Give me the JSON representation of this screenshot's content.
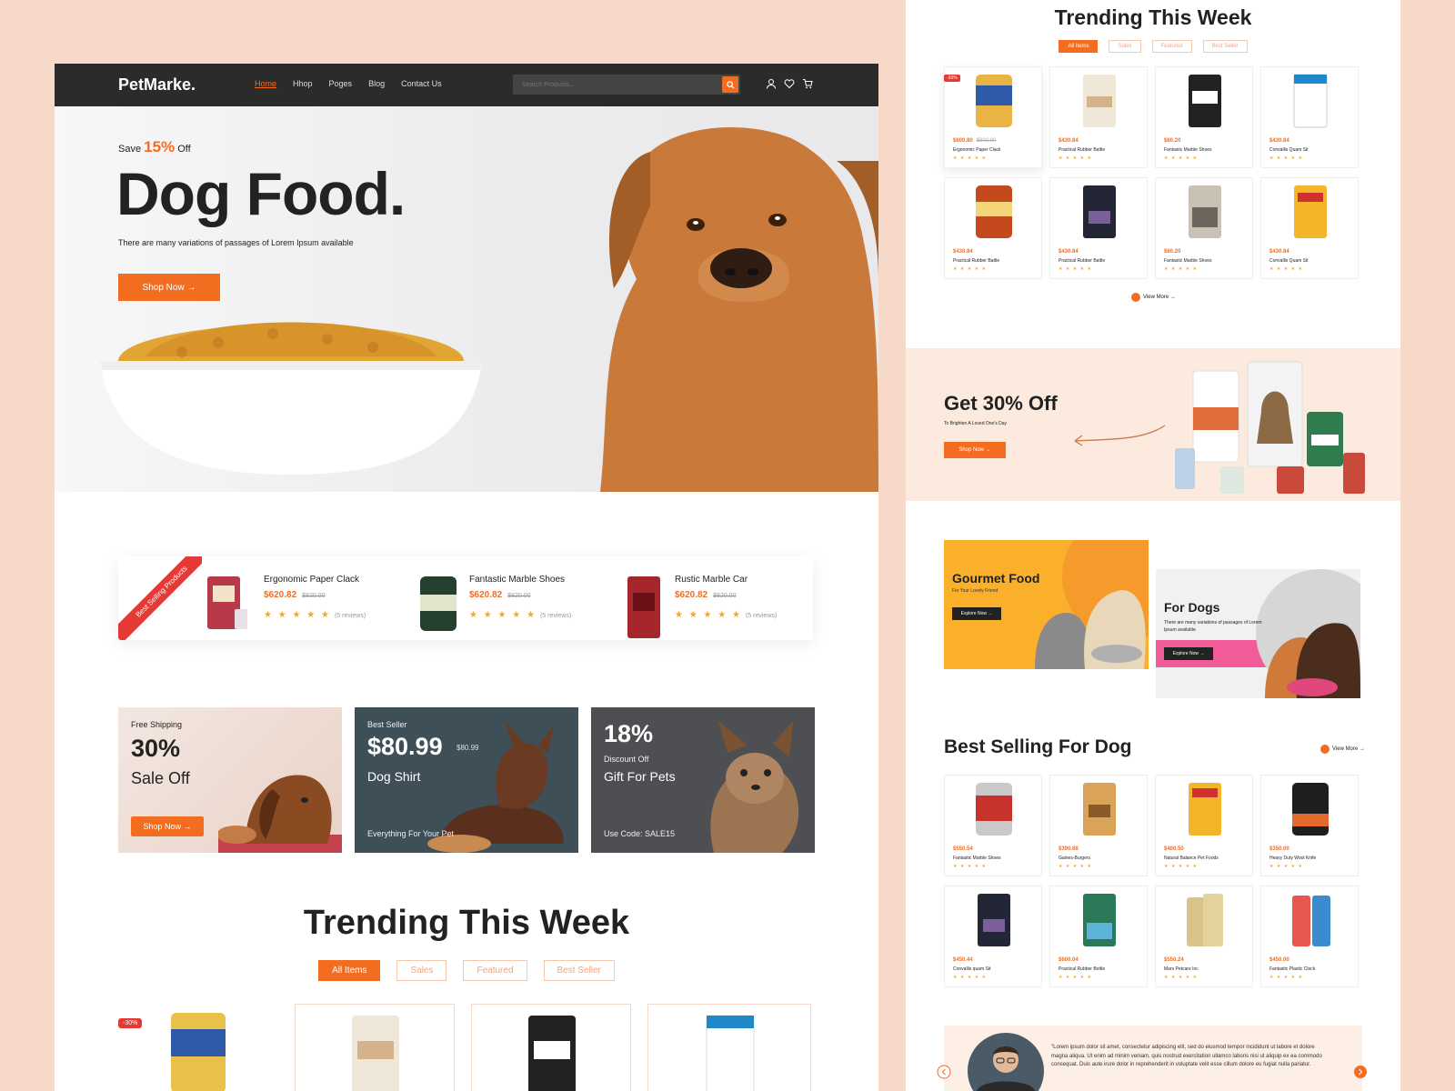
{
  "nav": {
    "logo": "PetMarke.",
    "items": [
      "Home",
      "Hhop",
      "Poges",
      "Blog",
      "Contact Us"
    ],
    "search_placeholder": "Search Products..."
  },
  "hero": {
    "save_prefix": "Save",
    "save_pct": "15%",
    "save_suffix": "Off",
    "title": "Dog Food.",
    "subtitle": "There are many variations of passages of Lorem Ipsum available",
    "cta": "Shop Now →"
  },
  "best_selling_strip": {
    "ribbon": "Best Selling Products",
    "items": [
      {
        "name": "Ergonomic Paper Clack",
        "price": "$620.82",
        "old": "$820.00",
        "stars": "★ ★ ★ ★ ★",
        "reviews": "(5 reviews)"
      },
      {
        "name": "Fantastic Marble Shoes",
        "price": "$620.82",
        "old": "$820.00",
        "stars": "★ ★ ★ ★ ★",
        "reviews": "(5 reviews)"
      },
      {
        "name": "Rustic Marble Car",
        "price": "$620.82",
        "old": "$820.00",
        "stars": "★ ★ ★ ★ ★",
        "reviews": "(5 reviews)"
      }
    ]
  },
  "promos": [
    {
      "kicker": "Free Shipping",
      "big": "30%",
      "line": "Sale Off",
      "cta": "Shop Now →"
    },
    {
      "kicker": "Best Seller",
      "big": "$80.99",
      "old": "$80.99",
      "line": "Dog Shirt",
      "foot": "Everything For Your Pet"
    },
    {
      "big": "18%",
      "kicker": "Discount Off",
      "line": "Gift For Pets",
      "foot": "Use Code: SALE15"
    }
  ],
  "trending": {
    "title": "Trending This Week",
    "tabs": [
      "All Items",
      "Sales",
      "Featured",
      "Best Seller"
    ],
    "discount_badge": "-30%"
  },
  "right": {
    "trending_title": "Trending This Week",
    "tabs": [
      "All Items",
      "Sales",
      "Featured",
      "Best Seller"
    ],
    "badge": "-30%",
    "products_row1": [
      {
        "price": "$600.80",
        "old": "$800.00",
        "name": "Ergonomic Paper Clack"
      },
      {
        "price": "$430.84",
        "name": "Practical Rubber Battle"
      },
      {
        "price": "$60.20",
        "name": "Fantastic Marble Shoes"
      },
      {
        "price": "$430.84",
        "name": "Convallis Quam Sit"
      }
    ],
    "products_row2": [
      {
        "price": "$430.84",
        "name": "Practical Rubber Battle"
      },
      {
        "price": "$430.84",
        "name": "Practical Rubber Battle"
      },
      {
        "price": "$60.20",
        "name": "Fantastic Marble Shoes"
      },
      {
        "price": "$430.84",
        "name": "Convallis Quam Sit"
      }
    ],
    "view_more": "View More →",
    "offer": {
      "title": "Get 30% Off",
      "sub": "To Brighten A Loved One's Day",
      "cta": "Shop Now →"
    },
    "gourmet": {
      "title": "Gourmet Food",
      "sub": "For Your Lovely Friend",
      "cta": "Explore Now →"
    },
    "for_dogs": {
      "title": "For Dogs",
      "sub": "There are many variations of passages of Lorem Ipsum available",
      "cta": "Explore Now →"
    },
    "best_selling_title": "Best Selling For Dog",
    "bs_row1": [
      {
        "price": "$550.54",
        "name": "Fantastic Marble Shoes"
      },
      {
        "price": "$390.88",
        "name": "Gaines-Burgers"
      },
      {
        "price": "$400.50",
        "name": "Natural Balance Pet Foods"
      },
      {
        "price": "$350.00",
        "name": "Heavy Duty Wool Knife"
      }
    ],
    "bs_row2": [
      {
        "price": "$450.44",
        "name": "Convallis quam Sit"
      },
      {
        "price": "$600.04",
        "name": "Practical Rubber Bottle"
      },
      {
        "price": "$550.24",
        "name": "Mars Petcare Inc"
      },
      {
        "price": "$450.00",
        "name": "Fantastic Plastic Clock"
      }
    ],
    "stars": "★ ★ ★ ★ ★",
    "testimonial": "\"Lorem ipsum dolor sit amet, consectetur adipiscing elit, sed do eiusmod tempor incididunt ut labore et dolore magna aliqua. Ut enim ad minim veniam, quis nostrud exercitation ullamco laboris nisi ut aliquip ex ea commodo consequat. Duis aute irure dolor in reprehenderit in voluptate velit esse cillum dolore eu fugiat nulla pariatur."
  },
  "colors": {
    "accent": "#f36d21",
    "dark": "#2b2b2b",
    "bg": "#f6d9c8"
  }
}
